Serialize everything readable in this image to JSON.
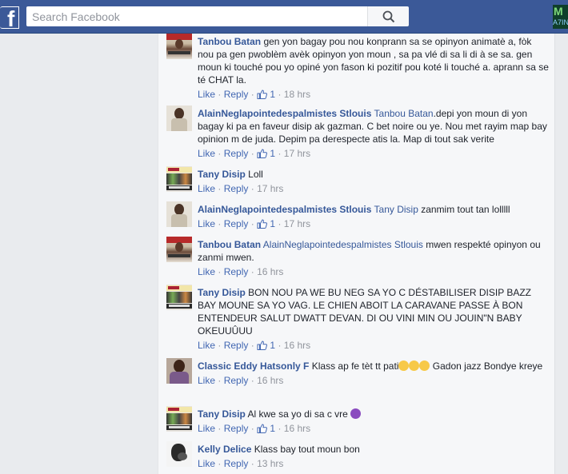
{
  "header": {
    "search_placeholder": "Search Facebook",
    "logo": "f",
    "ad_letter": "M",
    "ad_text": "A7IN"
  },
  "actions": {
    "like": "Like",
    "reply": "Reply",
    "separator": "·"
  },
  "comments": [
    {
      "author": "Tanbou Batan",
      "mention": "",
      "text": "gen yon bagay pou nou konprann sa se opinyon animatè a, fòk nou pa gen pwoblèm avèk opinyon yon moun , sa pa vlé di sa li di à se sa. gen moun ki touché pou yo opiné yon fason ki pozitif pou koté li touché a. aprann sa se té CHAT la.",
      "likes": "1",
      "time": "18 hrs"
    },
    {
      "author": "AlainNeglapointedespalmistes Stlouis",
      "mention": "Tanbou Batan",
      "text": ".depi yon moun di yon bagay ki pa en faveur disip ak gazman. C bet noire ou ye. Nou met rayim map bay opinion m de juda. Depim pa derespecte atis la. Map di tout sak verite",
      "likes": "1",
      "time": "17 hrs"
    },
    {
      "author": "Tany Disip",
      "mention": "",
      "text": "Loll",
      "likes": "",
      "time": "17 hrs"
    },
    {
      "author": "AlainNeglapointedespalmistes Stlouis",
      "mention": "Tany Disip",
      "text": " zanmim tout tan lolllll",
      "likes": "1",
      "time": "17 hrs"
    },
    {
      "author": "Tanbou Batan",
      "mention": "AlainNeglapointedespalmistes Stlouis",
      "text": " mwen respekté opinyon ou zanmi mwen.",
      "likes": "",
      "time": "16 hrs"
    },
    {
      "author": "Tany Disip",
      "mention": "",
      "text": "BON NOU PA WE BU NEG SA YO C DÉSTABILISER DISIP BAZZ BAY MOUNE SA YO VAG. LE CHIEN ABOIT LA CARAVANE PASSE À BON ENTENDEUR SALUT DWATT DEVAN. DI OU VINI MIN OU JOUIN\"N BABY OKEUUÛUU",
      "likes": "1",
      "time": "16 hrs"
    },
    {
      "author": "Classic Eddy Hatsonly F",
      "mention": "",
      "text_before": "Klass ap fe tèt tt pati",
      "text_after": "  Gadon jazz Bondye kreye",
      "likes": "",
      "time": "16 hrs"
    },
    {
      "author": "Tany Disip",
      "mention": "",
      "text": "Al kwe sa yo di sa c vre",
      "likes": "1",
      "time": "16 hrs"
    },
    {
      "author": "Kelly Delice",
      "mention": "",
      "text": "Klass bay tout moun bon",
      "likes": "",
      "time": "13 hrs"
    }
  ]
}
